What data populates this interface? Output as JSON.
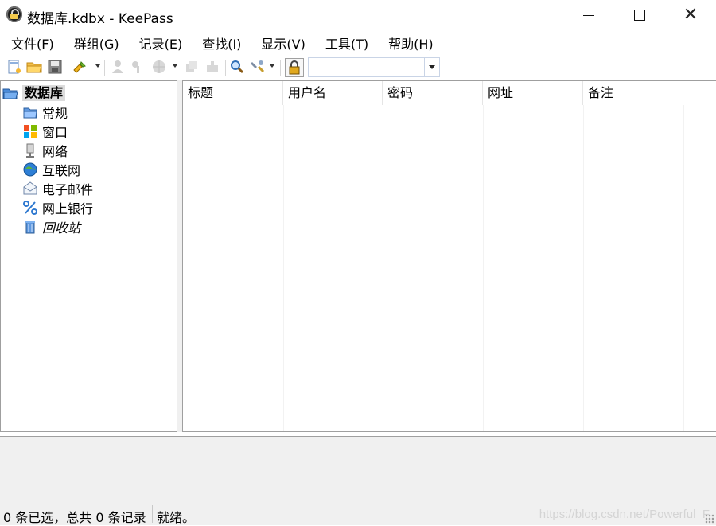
{
  "window": {
    "title": "数据库.kdbx - KeePass",
    "controls": [
      "minimize",
      "maximize",
      "close"
    ]
  },
  "menu": {
    "items": [
      "文件(F)",
      "群组(G)",
      "记录(E)",
      "查找(I)",
      "显示(V)",
      "工具(T)",
      "帮助(H)"
    ]
  },
  "toolbar": {
    "buttons": [
      {
        "name": "new-database-icon",
        "enabled": true
      },
      {
        "name": "open-database-icon",
        "enabled": true
      },
      {
        "name": "save-database-icon",
        "enabled": true
      },
      {
        "name": "add-entry-icon",
        "enabled": true
      },
      {
        "name": "copy-username-icon",
        "enabled": false
      },
      {
        "name": "copy-password-icon",
        "enabled": false
      },
      {
        "name": "open-url-icon",
        "enabled": false
      },
      {
        "name": "copy-entry-icon",
        "enabled": false
      },
      {
        "name": "autotype-icon",
        "enabled": false
      },
      {
        "name": "find-icon",
        "enabled": true
      },
      {
        "name": "tools-icon",
        "enabled": true
      },
      {
        "name": "lock-workspace-icon",
        "enabled": true
      }
    ],
    "search": {
      "value": ""
    }
  },
  "tree": {
    "root": {
      "label": "数据库",
      "icon": "folder-open-icon"
    },
    "groups": [
      {
        "label": "常规",
        "icon": "folder-icon"
      },
      {
        "label": "窗口",
        "icon": "windows-icon"
      },
      {
        "label": "网络",
        "icon": "network-icon"
      },
      {
        "label": "互联网",
        "icon": "globe-icon"
      },
      {
        "label": "电子邮件",
        "icon": "email-icon"
      },
      {
        "label": "网上银行",
        "icon": "percent-icon"
      },
      {
        "label": "回收站",
        "icon": "recycle-bin-icon",
        "italic": true
      }
    ]
  },
  "entries": {
    "columns": [
      "标题",
      "用户名",
      "密码",
      "网址",
      "备注"
    ],
    "rows": []
  },
  "status": {
    "selection": "0 条已选，总共 0 条记录",
    "message": "就绪。"
  },
  "watermark": "https://blog.csdn.net/Powerful_F"
}
